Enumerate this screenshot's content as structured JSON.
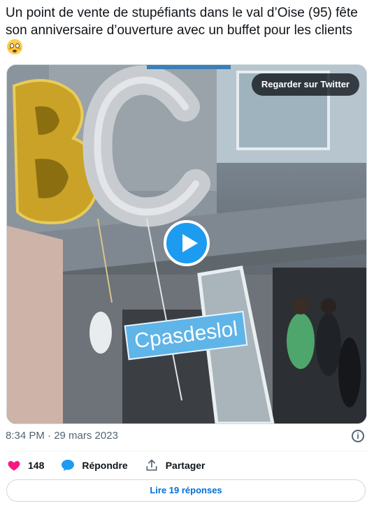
{
  "tweet": {
    "text": "Un point de vente de stupéfiants dans le val d’Oise (95) fête son anniversaire d’ouverture avec un buffet pour les clients",
    "emoji": "flushed-face-emoji"
  },
  "media": {
    "watch_label": "Regarder sur Twitter",
    "sticker_text": "Cpasdeslol",
    "balloon_letters": "BC",
    "play_icon": "play-icon"
  },
  "meta": {
    "time": "8:34 PM · 29 mars 2023",
    "info_icon": "info-icon"
  },
  "actions": {
    "likes": "148",
    "reply_label": "Répondre",
    "share_label": "Partager"
  },
  "replies_button": "Lire 19 réponses",
  "colors": {
    "like": "#f91880",
    "reply": "#1d9bf0",
    "link": "#006fd6",
    "play": "#1d9bf0"
  }
}
